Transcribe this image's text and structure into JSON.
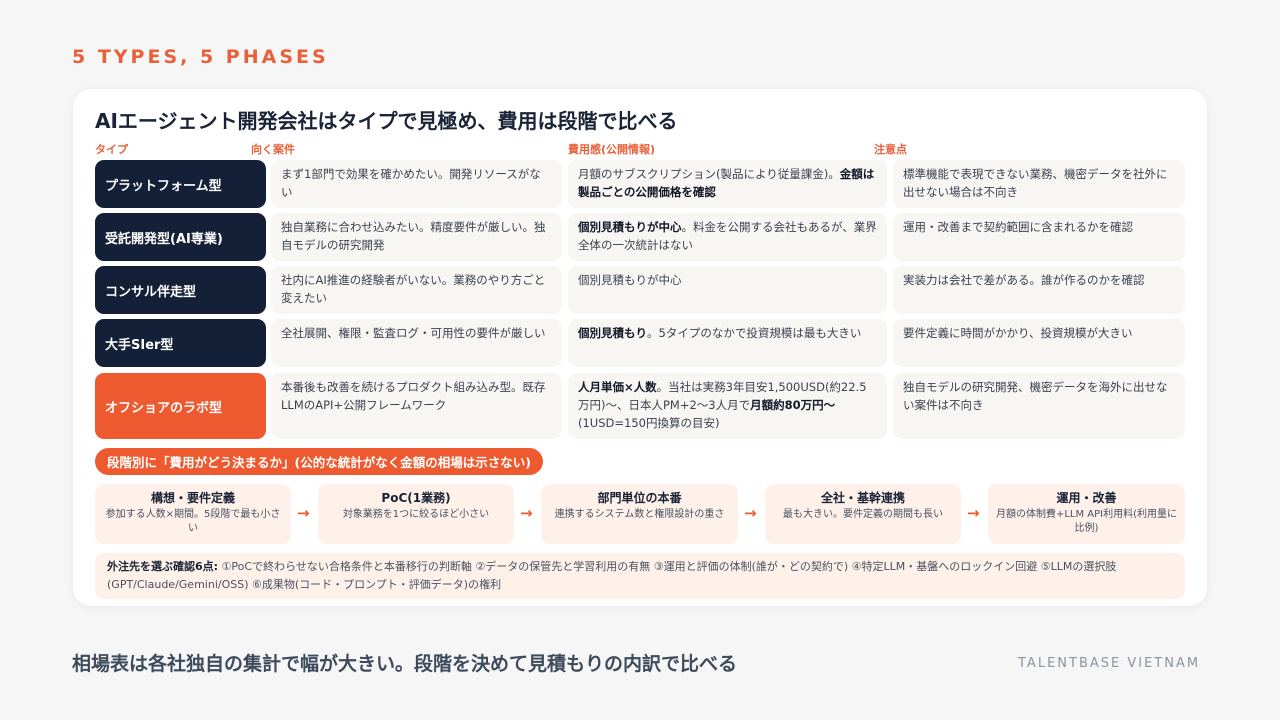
{
  "kicker": "5 TYPES, 5 PHASES",
  "title": "AIエージェント開発会社はタイプで見極め、費用は段階で比べる",
  "columns": {
    "type": "タイプ",
    "fit": "向く案件",
    "cost": "費用感(公開情報)",
    "caution": "注意点"
  },
  "rows": [
    {
      "type": "プラットフォーム型",
      "fit": "まず1部門で効果を確かめたい。開発リソースがない",
      "cost_pre": "月額のサブスクリプション(製品により従量課金)。",
      "cost_bold": "金額は製品ごとの公開価格を確認",
      "cost_post": "",
      "caution": "標準機能で表現できない業務、機密データを社外に出せない場合は不向き"
    },
    {
      "type": "受託開発型(AI専業)",
      "fit": "独自業務に合わせ込みたい。精度要件が厳しい。独自モデルの研究開発",
      "cost_pre": "",
      "cost_bold": "個別見積もりが中心",
      "cost_post": "。料金を公開する会社もあるが、業界全体の一次統計はない",
      "caution": "運用・改善まで契約範囲に含まれるかを確認"
    },
    {
      "type": "コンサル伴走型",
      "fit": "社内にAI推進の経験者がいない。業務のやり方ごと変えたい",
      "cost_pre": "個別見積もりが中心",
      "cost_bold": "",
      "cost_post": "",
      "caution": "実装力は会社で差がある。誰が作るのかを確認"
    },
    {
      "type": "大手SIer型",
      "fit": "全社展開、権限・監査ログ・可用性の要件が厳しい",
      "cost_pre": "",
      "cost_bold": "個別見積もり",
      "cost_post": "。5タイプのなかで投資規模は最も大きい",
      "caution": "要件定義に時間がかかり、投資規模が大きい"
    },
    {
      "type": "オフショアのラボ型",
      "fit": "本番後も改善を続けるプロダクト組み込み型。既存LLMのAPI+公開フレームワーク",
      "cost_pre": "",
      "cost_bold": "人月単価×人数",
      "cost_post": "。当社は実務3年目安1,500USD(約22.5万円)〜、日本人PM+2〜3人月で",
      "cost_bold2": "月額約80万円〜",
      "cost_post2": "(1USD=150円換算の目安)",
      "caution": "独自モデルの研究開発、機密データを海外に出せない案件は不向き"
    }
  ],
  "phase_label": "段階別に「費用がどう決まるか」(公的な統計がなく金額の相場は示さない)",
  "phases": [
    {
      "title": "構想・要件定義",
      "desc": "参加する人数×期間。5段階で最も小さい"
    },
    {
      "title": "PoC(1業務)",
      "desc": "対象業務を1つに絞るほど小さい"
    },
    {
      "title": "部門単位の本番",
      "desc": "連携するシステム数と権限設計の重さ"
    },
    {
      "title": "全社・基幹連携",
      "desc": "最も大きい。要件定義の期間も長い"
    },
    {
      "title": "運用・改善",
      "desc": "月額の体制費+LLM API利用料(利用量に比例)"
    }
  ],
  "arrow": "→",
  "checklist_label": "外注先を選ぶ確認6点:",
  "checklist_text": " ①PoCで終わらせない合格条件と本番移行の判断軸 ②データの保管先と学習利用の有無 ③運用と評価の体制(誰が・どの契約で) ④特定LLM・基盤へのロックイン回避 ⑤LLMの選択肢(GPT/Claude/Gemini/OSS) ⑥成果物(コード・プロンプト・評価データ)の権利",
  "footer": "相場表は各社独自の集計で幅が大きい。段階を決めて見積もりの内訳で比べる",
  "brand": "TALENTBASE VIETNAM"
}
